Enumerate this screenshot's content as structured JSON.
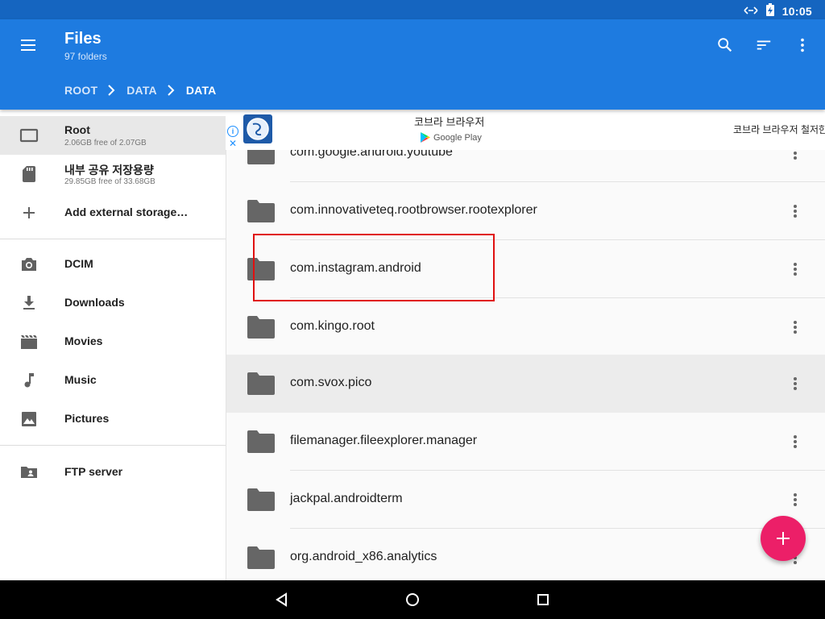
{
  "status_bar": {
    "time": "10:05",
    "icons": [
      "data-sync-icon",
      "battery-charging-icon"
    ]
  },
  "app_bar": {
    "title": "Files",
    "subtitle": "97 folders",
    "actions": [
      "search-icon",
      "sort-icon",
      "more-vert-icon"
    ],
    "breadcrumb": [
      "ROOT",
      "DATA",
      "DATA"
    ]
  },
  "sidebar": {
    "storage": [
      {
        "label": "Root",
        "sub": "2.06GB free of 2.07GB",
        "icon": "storage-icon",
        "selected": true
      },
      {
        "label": "내부 공유 저장용량",
        "sub": "29.85GB free of 33.68GB",
        "icon": "sd-card-icon",
        "selected": false
      },
      {
        "label": "Add external storage…",
        "icon": "plus-icon",
        "selected": false
      }
    ],
    "folders": [
      {
        "label": "DCIM",
        "icon": "camera-icon"
      },
      {
        "label": "Downloads",
        "icon": "download-icon"
      },
      {
        "label": "Movies",
        "icon": "movie-icon"
      },
      {
        "label": "Music",
        "icon": "music-note-icon"
      },
      {
        "label": "Pictures",
        "icon": "image-icon"
      }
    ],
    "other": [
      {
        "label": "FTP server",
        "icon": "ftp-folder-icon"
      }
    ]
  },
  "ad": {
    "title": "코브라 브라우저",
    "store": "Google Play",
    "right_text": "코브라 브라우저 철저한"
  },
  "file_list": {
    "rows": [
      {
        "name": "com.google.android.youtube",
        "highlight": false
      },
      {
        "name": "com.innovativeteq.rootbrowser.rootexplorer",
        "highlight": false
      },
      {
        "name": "com.instagram.android",
        "highlight": false
      },
      {
        "name": "com.kingo.root",
        "highlight": false
      },
      {
        "name": "com.svox.pico",
        "highlight": true
      },
      {
        "name": "filemanager.fileexplorer.manager",
        "highlight": false
      },
      {
        "name": "jackpal.androidterm",
        "highlight": false
      },
      {
        "name": "org.android_x86.analytics",
        "highlight": false
      }
    ]
  },
  "colors": {
    "status_bar": "#1565c0",
    "app_bar": "#1e7be0",
    "fab": "#ec1f68",
    "annotation": "#e01010"
  }
}
